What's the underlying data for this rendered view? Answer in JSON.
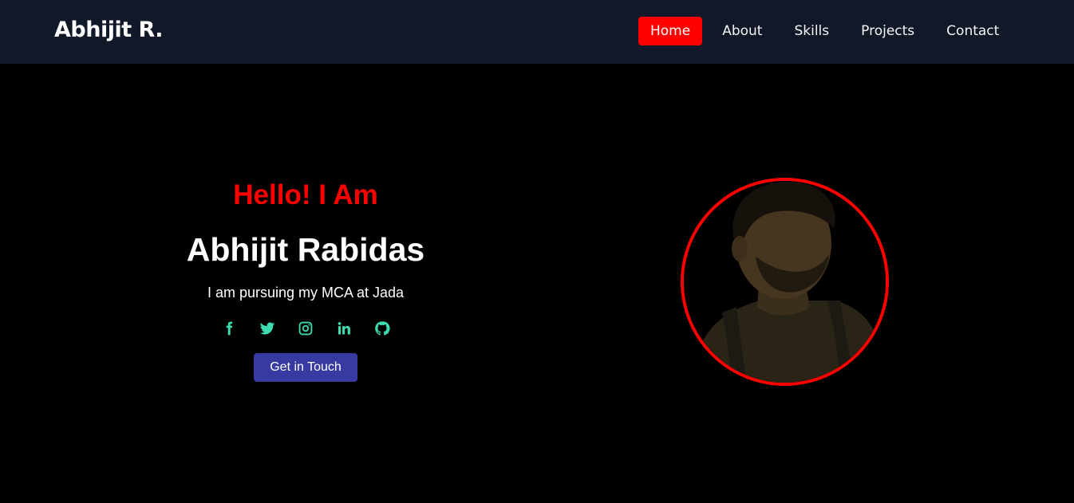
{
  "brand": {
    "name": "Abhijit R."
  },
  "nav": {
    "items": [
      {
        "label": "Home",
        "active": true
      },
      {
        "label": "About"
      },
      {
        "label": "Skills"
      },
      {
        "label": "Projects"
      },
      {
        "label": "Contact"
      }
    ]
  },
  "hero": {
    "greeting": "Hello! I Am",
    "name": "Abhijit Rabidas",
    "tagline": "I am pursuing my MCA at Jada",
    "cta_label": "Get in Touch",
    "socials": [
      "facebook-icon",
      "twitter-icon",
      "instagram-icon",
      "linkedin-icon",
      "github-icon"
    ]
  },
  "colors": {
    "accent": "#ff0000",
    "nav_bg": "#111827",
    "social_icon": "#3ddbb0",
    "cta_bg": "#373aa0",
    "page_bg": "#000000"
  }
}
